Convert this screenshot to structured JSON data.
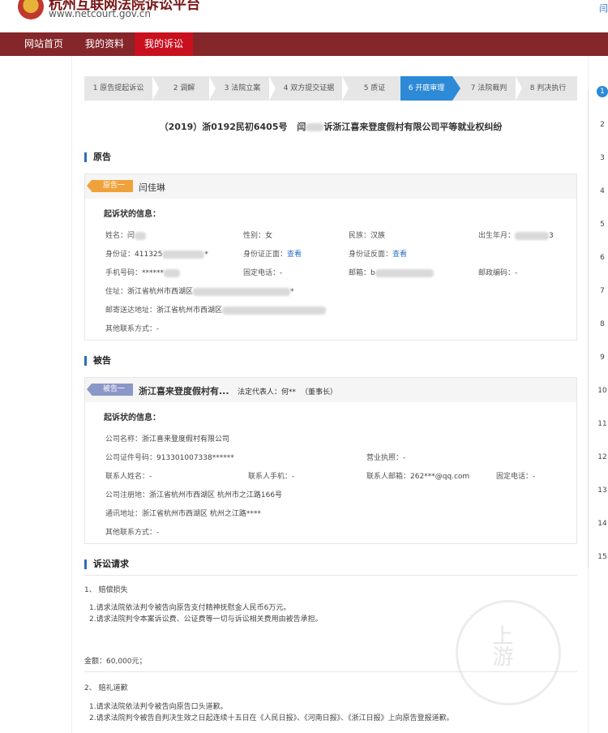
{
  "header": {
    "site_name": "杭州互联网法院诉讼平台",
    "site_url": "www.netcourt.gov.cn",
    "top_link": "闫"
  },
  "nav": {
    "items": [
      "网站首页",
      "我的资料",
      "我的诉讼"
    ],
    "active_index": 2
  },
  "steps": {
    "items": [
      "1 原告提起诉讼",
      "2 调解",
      "3 法院立案",
      "4 双方提交证据",
      "5 质证",
      "6 开庭审理",
      "7 法院裁判",
      "8 判决执行"
    ],
    "active_index": 5
  },
  "case_title": {
    "number": "（2019）浙0192民初6405号",
    "prefix": "闫",
    "suffix": "诉浙江喜来登度假村有限公司平等就业权纠纷"
  },
  "plaintiff": {
    "section_title": "原告",
    "tag": "原告一",
    "name": "闫佳琳",
    "subhead": "起诉状的信息：",
    "fields": {
      "name_label": "姓名：",
      "name_val": "闫",
      "gender_label": "性别：",
      "gender_val": "女",
      "ethnicity_label": "民族：",
      "ethnicity_val": "汉族",
      "birth_label": "出生年月：",
      "birth_val": "3",
      "id_label": "身份证：",
      "id_val": "411325",
      "id_tail": "*",
      "id_front_label": "身份证正面：",
      "id_front_link": "查看",
      "id_back_label": "身份证反面：",
      "id_back_link": "查看",
      "phone_label": "手机号码：",
      "phone_val": "******",
      "landline_label": "固定电话：",
      "landline_val": "-",
      "email_label": "邮箱：",
      "email_val": "b",
      "postcode_label": "邮政编码：",
      "postcode_val": "-",
      "address_label": "住址：",
      "address_val": "浙江省杭州市西湖区",
      "address_tail": "*",
      "mail_address_label": "邮寄送达地址：",
      "mail_address_val": "浙江省杭州市西湖区",
      "other_label": "其他联系方式：",
      "other_val": "-"
    }
  },
  "defendant": {
    "section_title": "被告",
    "tag": "被告一",
    "name": "浙江喜来登度假村有...",
    "rep_label": "法定代表人：",
    "rep_val": "何**",
    "rep_role": "（董事长）",
    "subhead": "起诉状的信息：",
    "fields": {
      "company_label": "公司名称：",
      "company_val": "浙江喜来登度假村有限公司",
      "cert_label": "公司证件号码：",
      "cert_val": "913301007338******",
      "license_label": "营业执照：",
      "license_val": "-",
      "contact_name_label": "联系人姓名：",
      "contact_name_val": "-",
      "contact_phone_label": "联系人手机：",
      "contact_phone_val": "-",
      "contact_email_label": "联系人邮箱：",
      "contact_email_val": "262***@qq.com",
      "landline_label": "固定电话：",
      "landline_val": "-",
      "reg_address_label": "公司注册地：",
      "reg_address_val": "浙江省杭州市西湖区 杭州市之江路166号",
      "mail_address_label": "通讯地址：",
      "mail_address_val": "浙江省杭州市西湖区 杭州之江路****",
      "other_label": "其他联系方式：",
      "other_val": "-"
    }
  },
  "claims": {
    "section_title": "诉讼请求",
    "item1_title": "1、 赔偿损失",
    "item1_lines": [
      "1.请求法院依法判令被告向原告支付精神抚慰金人民币6万元。",
      "2.请求法院判令本案诉讼费、公证费等一切与诉讼相关费用由被告承担。"
    ],
    "amount": "金额：60,000元；",
    "item2_title": "2、 赔礼道歉",
    "item2_lines": [
      "1.请求法院依法判令被告向原告口头道歉。",
      "2.请求法院判令被告自判决生效之日起连续十五日在《人民日报》、《河南日报》、《浙江日报》上向原告登报道歉。"
    ]
  },
  "side_nav": {
    "numbers": [
      "1",
      "2",
      "3",
      "4",
      "5",
      "6",
      "7",
      "8",
      "9",
      "10",
      "11",
      "12",
      "13",
      "14",
      "15"
    ],
    "active_index": 0
  },
  "watermark": "上游"
}
